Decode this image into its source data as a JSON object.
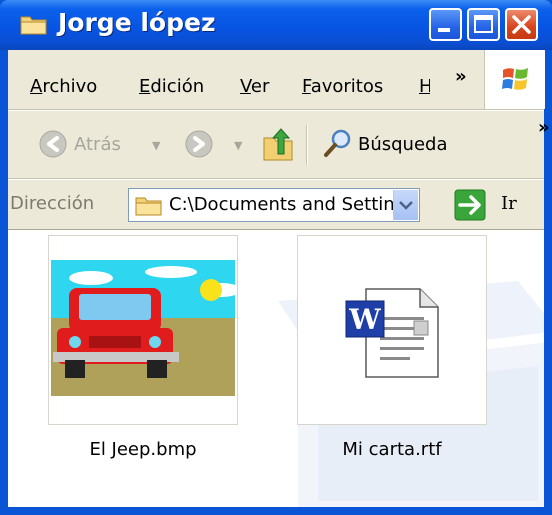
{
  "window": {
    "title": "Jorge lópez"
  },
  "menubar": {
    "items": [
      {
        "label": "Archivo",
        "u": "A",
        "rest": "rchivo"
      },
      {
        "label": "Edición",
        "u": "E",
        "rest": "dición"
      },
      {
        "label": "Ver",
        "u": "V",
        "rest": "er"
      },
      {
        "label": "Favoritos",
        "u": "F",
        "rest": "avoritos"
      },
      {
        "label": "H",
        "u": "H",
        "rest": ""
      }
    ],
    "overflow": "»"
  },
  "toolbar": {
    "back_label": "Atrás",
    "search_label": "Búsqueda",
    "overflow": "»"
  },
  "address": {
    "label": "Dirección",
    "path": "C:\\Documents and Settings\\Jorge lópez",
    "go_label": "Ir"
  },
  "files": [
    {
      "name": "El Jeep.bmp",
      "icon": "jeep-bitmap-thumbnail"
    },
    {
      "name": "Mi carta.rtf",
      "icon": "word-document-icon"
    }
  ],
  "colors": {
    "titlebar": "#0854e3",
    "chrome": "#ece9d8",
    "close_button": "#d8431c",
    "go_arrow": "#3aa53a"
  }
}
